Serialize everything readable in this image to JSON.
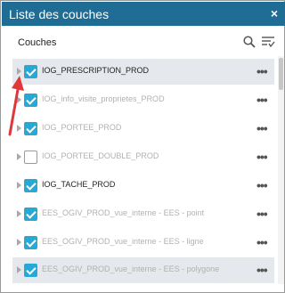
{
  "panel": {
    "title": "Liste des couches",
    "close_glyph": "×"
  },
  "toolbar": {
    "label": "Couches",
    "search_icon": "search-icon",
    "filter_icon": "filter-list-icon"
  },
  "layers": [
    {
      "name": "IOG_PRESCRIPTION_PROD",
      "checked": true,
      "active": true,
      "selected": true
    },
    {
      "name": "IOG_info_visite_proprietes_PROD",
      "checked": true,
      "active": false,
      "selected": false
    },
    {
      "name": "IOG_PORTEE_PROD",
      "checked": true,
      "active": false,
      "selected": false
    },
    {
      "name": "IOG_PORTEE_DOUBLE_PROD",
      "checked": false,
      "active": false,
      "selected": false
    },
    {
      "name": "IOG_TACHE_PROD",
      "checked": true,
      "active": true,
      "selected": false
    },
    {
      "name": "EES_OGIV_PROD_vue_interne - EES - point",
      "checked": true,
      "active": false,
      "selected": false
    },
    {
      "name": "EES_OGIV_PROD_vue_interne - EES - ligne",
      "checked": true,
      "active": false,
      "selected": false
    },
    {
      "name": "EES_OGIV_PROD_vue_interne - EES - polygone",
      "checked": true,
      "active": false,
      "selected": true
    }
  ],
  "row_menu_glyph": "•••",
  "colors": {
    "header": "#1f6d95",
    "checkbox": "#27a9d6",
    "selected_row": "#e5e8ed",
    "annotation_arrow": "#e0383a"
  }
}
